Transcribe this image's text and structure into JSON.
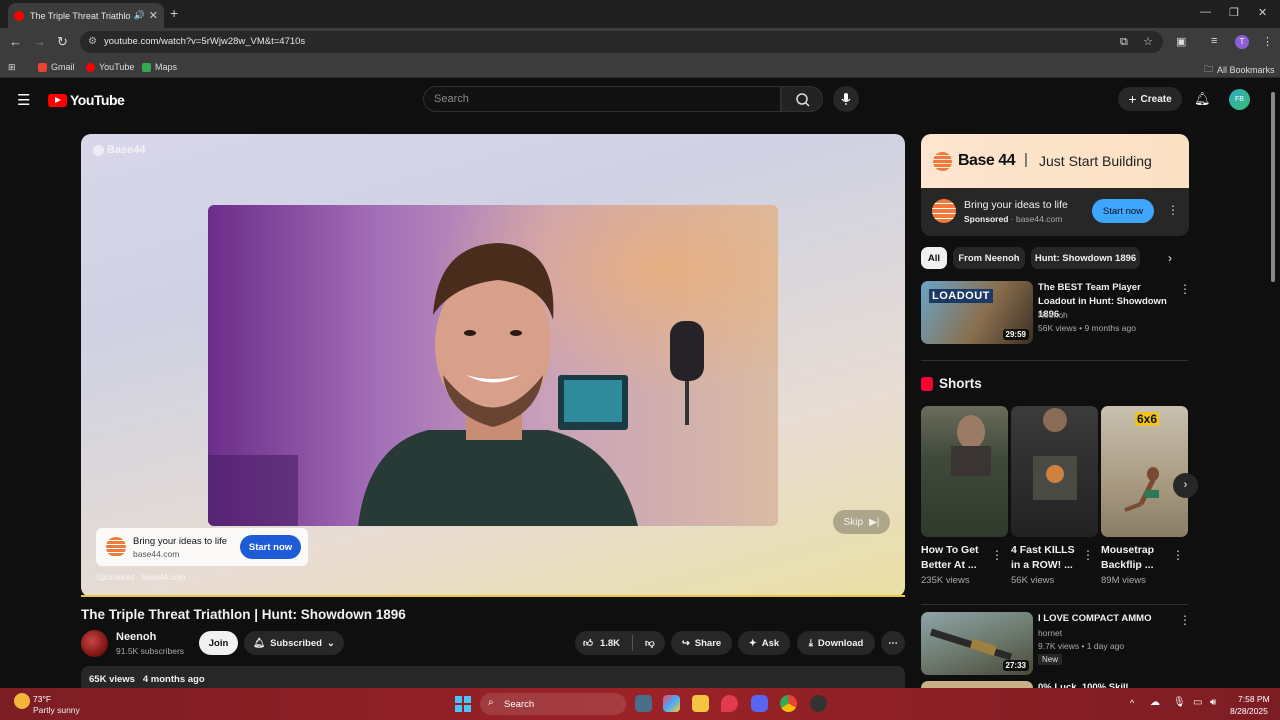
{
  "browser": {
    "tab_title": "The Triple Threat Triathlon | Hunt: Showdown 1896 - YouTube",
    "url": "youtube.com/watch?v=5rWjw28w_VM&t=4710s",
    "profile_initial": "T",
    "bookmarks": [
      "Gmail",
      "YouTube",
      "Maps"
    ],
    "all_bookmarks": "All Bookmarks"
  },
  "header": {
    "logo_text": "YouTube",
    "search_placeholder": "Search",
    "create_label": "Create",
    "avatar_text": "FB"
  },
  "player": {
    "watermark": "Base44",
    "skip_label": "Skip",
    "ad_card": {
      "headline": "Bring your ideas to life",
      "domain": "base44.com",
      "cta": "Start now"
    },
    "sponsored_line": "Sponsored · base44.com"
  },
  "video": {
    "title": "The Triple Threat Triathlon | Hunt: Showdown 1896",
    "channel": "Neenoh",
    "subscribers": "91.5K subscribers",
    "join_label": "Join",
    "subscribed_label": "Subscribed",
    "likes": "1.8K",
    "share_label": "Share",
    "ask_label": "Ask",
    "download_label": "Download",
    "views": "65K views",
    "age": "4 months ago"
  },
  "sidebar_ad": {
    "brand": "Base 44",
    "separator": "|",
    "tagline": "Just Start Building",
    "headline": "Bring your ideas to life",
    "sponsored": "Sponsored",
    "domain": "· base44.com",
    "cta": "Start now"
  },
  "chips": [
    "All",
    "From Neenoh",
    "Hunt: Showdown 1896"
  ],
  "recommendations": [
    {
      "title": "The BEST Team Player Loadout in Hunt: Showdown 1896",
      "channel": "Neenoh",
      "meta": "56K views • 9 months ago",
      "duration": "29:59",
      "thumb_text": "LOADOUT"
    },
    {
      "title": "I LOVE COMPACT AMMO",
      "channel": "hornet",
      "meta": "9.7K views • 1 day ago",
      "badge": "New",
      "duration": "27:33"
    },
    {
      "title": "0% Luck, 100% Skill"
    }
  ],
  "shorts": {
    "label": "Shorts",
    "items": [
      {
        "title": "How To Get Better At ...",
        "views": "235K views"
      },
      {
        "title": "4 Fast KILLS in a ROW! ...",
        "views": "56K views"
      },
      {
        "title": "Mousetrap Backflip ...",
        "views": "89M views",
        "overlay": "6x6"
      }
    ]
  },
  "taskbar": {
    "temp": "73°F",
    "weather": "Partly sunny",
    "search": "Search",
    "time": "7:58 PM",
    "date": "8/28/2025"
  },
  "colors": {
    "yt_red": "#ff0000",
    "cta_blue": "#3ea6ff",
    "ad_cta_blue": "#1e5bd7",
    "taskbar": "#9a2227"
  }
}
